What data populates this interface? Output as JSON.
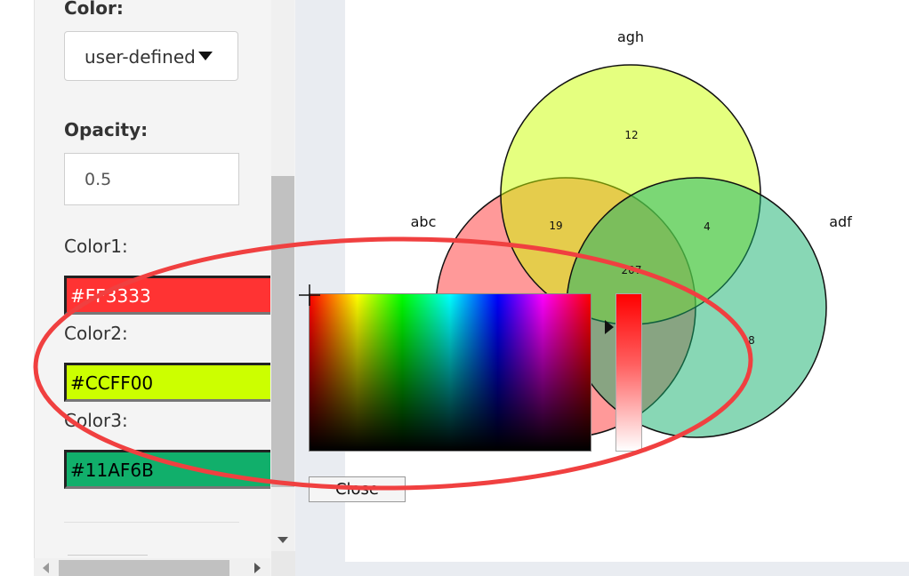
{
  "sidebar": {
    "color_label": "Color:",
    "color_select_value": "user-defined",
    "opacity_label": "Opacity:",
    "opacity_value": "0.5",
    "color1_label": "Color1:",
    "color1_value": "#FF3333",
    "color1_display": "#FF3333",
    "color2_label": "Color2:",
    "color2_value": "#CCFF00",
    "color3_label": "Color3:",
    "color3_value": "#11AF6B"
  },
  "picker": {
    "close_label": "Close"
  },
  "venn": {
    "sets": [
      {
        "name": "abc",
        "color": "#FF3333"
      },
      {
        "name": "agh",
        "color": "#CCFF00"
      },
      {
        "name": "adf",
        "color": "#11AF6B"
      }
    ],
    "counts": {
      "agh_only": "12",
      "abc_agh": "19",
      "agh_adf": "4",
      "all_three": "207",
      "adf_only": "8"
    },
    "opacity": 0.5
  },
  "annotation": {
    "color": "#F04040"
  }
}
